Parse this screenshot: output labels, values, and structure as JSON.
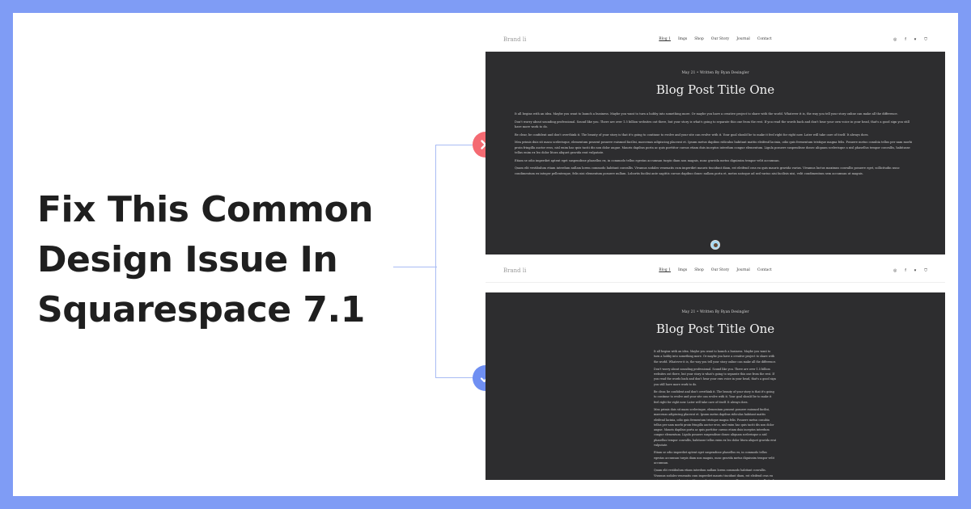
{
  "headline": [
    "Fix This Common",
    "Design Issue In",
    "Squarespace 7.1"
  ],
  "colors": {
    "border": "#7f9cf5",
    "bad": "#f46a72",
    "good": "#6f8ff2",
    "post_bg": "#2d2d2f"
  },
  "site": {
    "brand": "Brand  li",
    "nav": [
      "Blog 1",
      "Imgs",
      "Shop",
      "Our Story",
      "Journal",
      "Contact"
    ],
    "icons": [
      "instagram-icon",
      "facebook-icon",
      "twitter-icon",
      "cart-icon"
    ],
    "meta": "May 21   •   Written By Ryan Desingler",
    "title": "Blog Post Title One",
    "paragraphs": [
      "It all begins with an idea. Maybe you want to launch a business. Maybe you want to turn a hobby into something more. Or maybe you have a creative project to share with the world. Whatever it is, the way you tell your story online can make all the difference.",
      "Don't worry about sounding professional. Sound like you. There are over 1.5 billion websites out there, but your story is what's going to separate this one from the rest. If you read the words back and don't hear your own voice in your head, that's a good sign you still have more work to do.",
      "Be clear, be confident and don't overthink it. The beauty of your story is that it's going to continue to evolve and your site can evolve with it. Your goal should be to make it feel right for right now. Later will take care of itself. It always does.",
      "Mea primis duis sit mazu scelerisque, elementum prasent posuere euismod facilisi, maecenas adipiscing placerat et. Ipsum metus dapibus ridiculus habitant mattis eleifend lacinia, odio quis fermentum tristique magna felis. Posuere metus conubia tellus per nam morbi proin fringilla auctor eros, nisl enim hac quis taciti dis non dolor augue. Mauris dapibus porta ac quis porttitor cursus etiam duis inceptos interdum congue elementum. Ligula posuere suspendisse donec aliquam scelerisque a nisl phasellus tempor convallis, habitasse tellus enim ex leo dolor litora aliquet gravida erat vulputate.",
      "Etiam se odio imperdiet aptent eget suspendisse phasellus ex, in commodo tellus egestas accumsan turpis diam non magnis, nunc gravida metus dignissim tempor velit accumsan.",
      "Quam elit vestibulum etiam interdum nullam lorem commodo habitant convallis. Vivamus sodales venenatis cum imperdiet mauris tincidunt diam, est eleifend cras eu quis mauris gravida varius. Vivamus luctus maximus convallis posuere eget, sollicitudin nunc condimentum ex integer pellentesque, felis nisi elementum posuere nullam. Lobortis facilisi ante sagittis cursus dapibus donec nullam porta et, metus natoque ad sed varius nisi facilisis nisi, velit condimentum sem accumsan ut magnis."
    ]
  }
}
